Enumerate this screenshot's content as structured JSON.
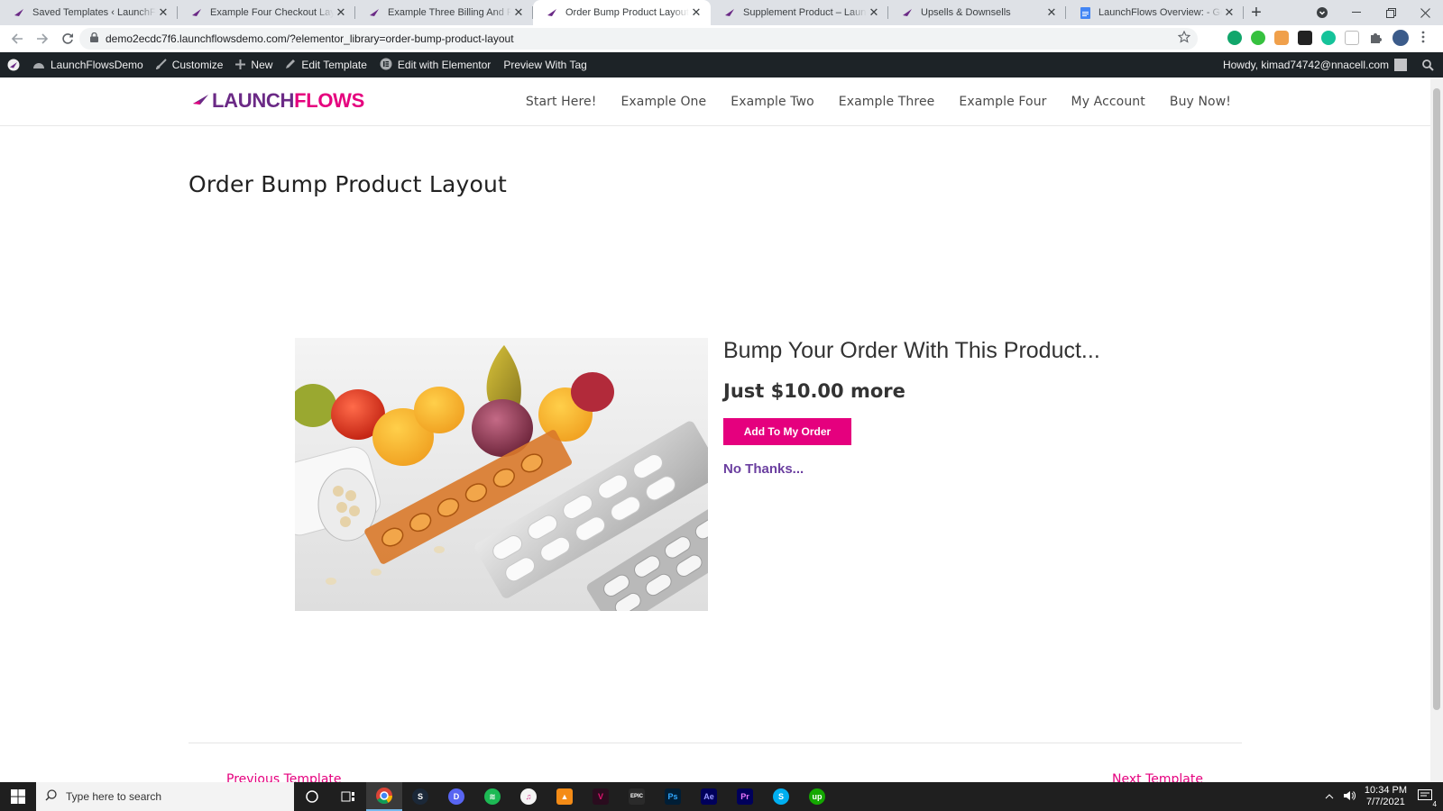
{
  "browser": {
    "tabs": [
      {
        "title": "Saved Templates ‹ LaunchFlowsD",
        "active": false
      },
      {
        "title": "Example Four Checkout Layout –",
        "active": false
      },
      {
        "title": "Example Three Billing And Paym",
        "active": false
      },
      {
        "title": "Order Bump Product Layout – La",
        "active": true
      },
      {
        "title": "Supplement Product – LaunchFlo",
        "active": false
      },
      {
        "title": "Upsells & Downsells",
        "active": false
      },
      {
        "title": "LaunchFlows Overview: - Google",
        "active": false
      }
    ],
    "close_glyph": "✕",
    "new_tab_glyph": "+",
    "url": "demo2ecdc7f6.launchflowsdemo.com/?elementor_library=order-bump-product-layout"
  },
  "admin_bar": {
    "site_name": "LaunchFlowsDemo",
    "customize": "Customize",
    "new": "New",
    "edit_template": "Edit Template",
    "edit_elementor": "Edit with Elementor",
    "preview_tag": "Preview With Tag",
    "howdy": "Howdy, kimad74742@nnacell.com"
  },
  "site": {
    "logo_part1": "LAUNCH",
    "logo_part2": "FLOWS",
    "nav": [
      "Start Here!",
      "Example One",
      "Example Two",
      "Example Three",
      "Example Four",
      "My Account",
      "Buy Now!"
    ]
  },
  "page": {
    "title": "Order Bump Product Layout",
    "bump_heading": "Bump Your Order With This Product...",
    "price": "Just $10.00 more",
    "add_button": "Add To My Order",
    "no_thanks": "No Thanks...",
    "prev_link": "Previous Template",
    "next_link": "Next Template"
  },
  "taskbar": {
    "search_placeholder": "Type here to search",
    "time": "10:34 PM",
    "date": "7/7/2021",
    "notification_count": "4"
  },
  "colors": {
    "brand_pink": "#e5007e",
    "brand_purple": "#6b2a86",
    "admin_bar": "#1d2327"
  }
}
